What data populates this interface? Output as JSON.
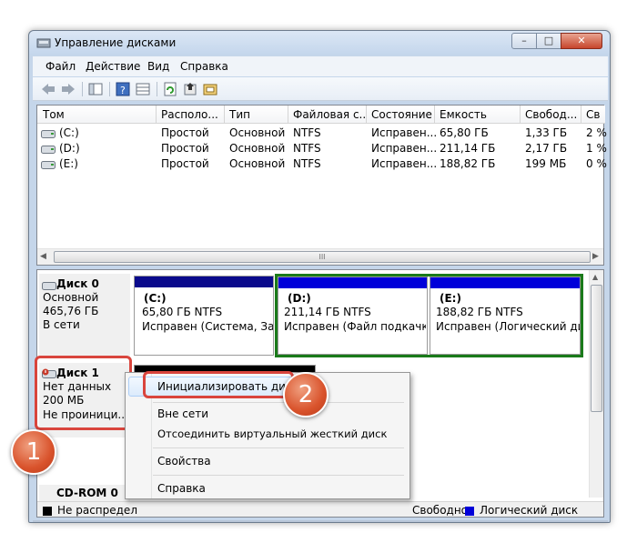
{
  "window": {
    "title": "Управление дисками",
    "buttons": {
      "minimize": "–",
      "maximize": "□",
      "close": "✕"
    }
  },
  "menu": [
    "Файл",
    "Действие",
    "Вид",
    "Справка"
  ],
  "toolbar": [
    "back-icon",
    "forward-icon",
    "console-tree-icon",
    "help-icon",
    "refresh-icon",
    "properties-icon",
    "rescan-icon"
  ],
  "volumes": {
    "columns": [
      "Том",
      "Располо...",
      "Тип",
      "Файловая с...",
      "Состояние",
      "Емкость",
      "Свобод...",
      "Св"
    ],
    "rows": [
      [
        "(C:)",
        "Простой",
        "Основной",
        "NTFS",
        "Исправен...",
        "65,80 ГБ",
        "1,33 ГБ",
        "2 %"
      ],
      [
        "(D:)",
        "Простой",
        "Основной",
        "NTFS",
        "Исправен...",
        "211,14 ГБ",
        "2,17 ГБ",
        "1 %"
      ],
      [
        "(E:)",
        "Простой",
        "Основной",
        "NTFS",
        "Исправен...",
        "188,82 ГБ",
        "199 МБ",
        "0 %"
      ]
    ],
    "scroll_grip": "III"
  },
  "disks": {
    "disk0": {
      "name": "Диск 0",
      "type": "Основной",
      "size": "465,76 ГБ",
      "status": "В сети",
      "partitions": [
        {
          "letter": "(C:)",
          "size": "65,80 ГБ NTFS",
          "state": "Исправен (Система, Загр"
        },
        {
          "letter": "(D:)",
          "size": "211,14 ГБ NTFS",
          "state": "Исправен (Файл подкачки,"
        },
        {
          "letter": "(E:)",
          "size": "188,82 ГБ NTFS",
          "state": "Исправен (Логический дис"
        }
      ]
    },
    "disk1": {
      "name": "Диск 1",
      "type": "Нет данных",
      "size": "200 МБ",
      "status": "Не проиници..."
    },
    "cdrom": {
      "name": "CD-ROM 0"
    }
  },
  "legend": {
    "unallocated": "Не распредел",
    "free": "Свободно",
    "logical": "Логический диск"
  },
  "context_menu": {
    "initialize": "Инициализировать диск",
    "offline": "Вне сети",
    "detach": "Отсоединить виртуальный жесткий диск",
    "properties": "Свойства",
    "help": "Справка"
  },
  "badges": {
    "one": "1",
    "two": "2"
  },
  "colors": {
    "primary_bar": "#0a0a8c",
    "logical_bar": "#0000d9",
    "selection_green": "#1a7a1a",
    "highlight_red": "#d9453d"
  }
}
